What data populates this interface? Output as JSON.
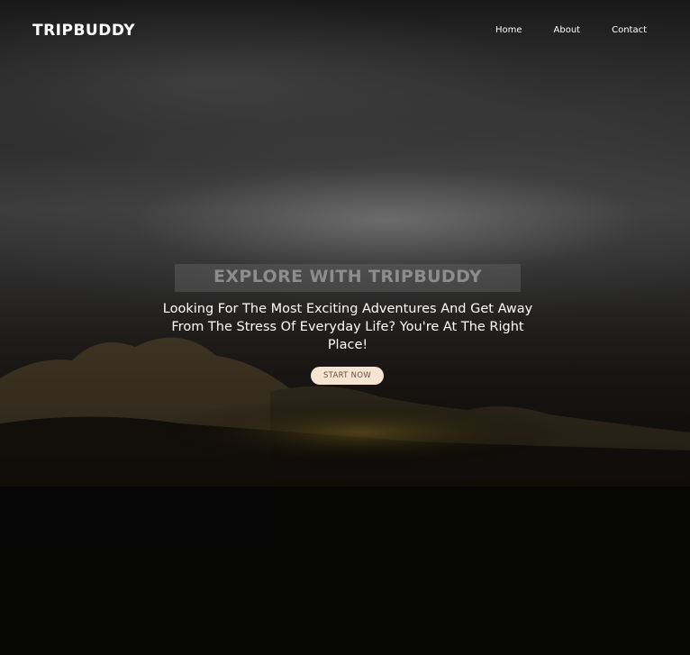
{
  "brand": {
    "name": "TRIPBUDDY"
  },
  "nav": {
    "items": [
      {
        "label": "Home"
      },
      {
        "label": "About"
      },
      {
        "label": "Contact"
      }
    ]
  },
  "hero": {
    "heading": "EXPLORE WITH TRIPBUDDY",
    "subtext": "Looking For The Most Exciting Adventures And Get Away From The Stress Of Everyday Life? You're At The Right Place!",
    "cta_label": "START NOW"
  },
  "colors": {
    "cta_background": "#f5e4d2",
    "cta_text": "#6d4e3d",
    "heading": "#8d8d8d",
    "text": "#ffffff"
  }
}
